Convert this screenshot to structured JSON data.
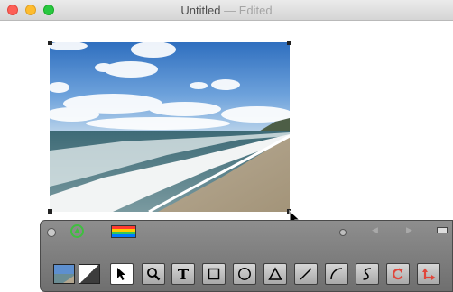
{
  "window": {
    "title": "Untitled",
    "separator": "—",
    "status": "Edited"
  },
  "palette": {
    "tools": [
      {
        "name": "select-arrow-tool",
        "icon": "arrow-pointer-icon",
        "selected": true
      },
      {
        "name": "zoom-tool",
        "icon": "magnifier-icon",
        "selected": false
      },
      {
        "name": "text-tool",
        "icon": "text-t-icon",
        "selected": false
      },
      {
        "name": "rectangle-tool",
        "icon": "rectangle-icon",
        "selected": false
      },
      {
        "name": "oval-tool",
        "icon": "circle-icon",
        "selected": false
      },
      {
        "name": "polygon-tool",
        "icon": "triangle-icon",
        "selected": false
      },
      {
        "name": "line-tool",
        "icon": "line-icon",
        "selected": false
      },
      {
        "name": "arc-tool",
        "icon": "arc-icon",
        "selected": false
      },
      {
        "name": "freehand-tool",
        "icon": "squiggle-icon",
        "selected": false
      },
      {
        "name": "rotate-tool",
        "icon": "rotate-icon",
        "selected": false
      },
      {
        "name": "flip-tool",
        "icon": "flip-arrows-icon",
        "selected": false
      }
    ]
  },
  "colors": {
    "accent_red": "#e0463b",
    "green_indicator": "#3fbf3f"
  }
}
